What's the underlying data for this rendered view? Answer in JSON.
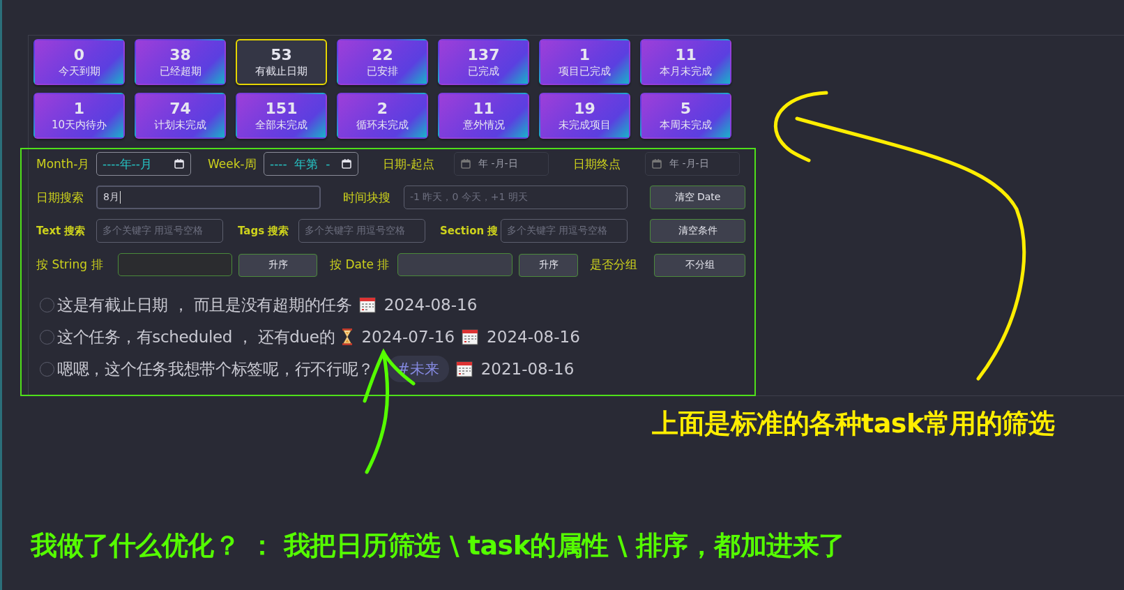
{
  "stat_cards": [
    {
      "count": "0",
      "label": "今天到期",
      "selected": false
    },
    {
      "count": "38",
      "label": "已经超期",
      "selected": false
    },
    {
      "count": "53",
      "label": "有截止日期",
      "selected": true
    },
    {
      "count": "22",
      "label": "已安排",
      "selected": false
    },
    {
      "count": "137",
      "label": "已完成",
      "selected": false
    },
    {
      "count": "1",
      "label": "项目已完成",
      "selected": false
    },
    {
      "count": "11",
      "label": "本月未完成",
      "selected": false
    },
    {
      "count": "1",
      "label": "10天内待办",
      "selected": false
    },
    {
      "count": "74",
      "label": "计划未完成",
      "selected": false
    },
    {
      "count": "151",
      "label": "全部未完成",
      "selected": false
    },
    {
      "count": "2",
      "label": "循环未完成",
      "selected": false
    },
    {
      "count": "11",
      "label": "意外情况",
      "selected": false
    },
    {
      "count": "19",
      "label": "未完成项目",
      "selected": false
    },
    {
      "count": "5",
      "label": "本周未完成",
      "selected": false
    }
  ],
  "filter_rows": [
    [
      {
        "kind": "label",
        "text": "Month-月"
      },
      {
        "kind": "month",
        "value": "----年--月"
      },
      {
        "kind": "label",
        "text": "Week-周"
      },
      {
        "kind": "week",
        "value": "----  年第  -"
      },
      {
        "kind": "label",
        "text": "日期-起点"
      },
      {
        "kind": "date",
        "placeholder": "年 -月-日"
      },
      {
        "kind": "label",
        "text": "日期终点"
      },
      {
        "kind": "date",
        "placeholder": "年 -月-日"
      }
    ],
    [
      {
        "kind": "label",
        "text": "日期搜索"
      },
      {
        "kind": "text",
        "value": "8月",
        "focused": true
      },
      {
        "kind": "label",
        "text": "时间块搜"
      },
      {
        "kind": "text",
        "placeholder": "-1 昨天，0 今天，+1 明天",
        "focused": false
      },
      {
        "kind": "button",
        "text": "清空 Date"
      }
    ],
    [
      {
        "kind": "small-label",
        "text": "Text 搜索"
      },
      {
        "kind": "text",
        "placeholder": "多个关键字 用逗号空格",
        "focused": false
      },
      {
        "kind": "small-label",
        "text": "Tags 搜索"
      },
      {
        "kind": "text",
        "placeholder": "多个关键字 用逗号空格",
        "focused": false
      },
      {
        "kind": "small-label",
        "text": "Section 搜"
      },
      {
        "kind": "text",
        "placeholder": "多个关键字 用逗号空格",
        "focused": false
      },
      {
        "kind": "button",
        "text": "清空条件"
      }
    ],
    [
      {
        "kind": "label",
        "text": "按 String 排"
      },
      {
        "kind": "sort-field"
      },
      {
        "kind": "button",
        "text": "升序"
      },
      {
        "kind": "label",
        "text": "按 Date 排"
      },
      {
        "kind": "select"
      },
      {
        "kind": "button",
        "text": "升序"
      },
      {
        "kind": "label",
        "text": "是否分组"
      },
      {
        "kind": "button",
        "text": "不分组"
      }
    ]
  ],
  "tasks": [
    {
      "checked": false,
      "parts": [
        {
          "kind": "text",
          "text": "这是有截止日期 ， 而且是没有超期的任务"
        },
        {
          "kind": "due",
          "date": "2024-08-16"
        }
      ]
    },
    {
      "checked": false,
      "parts": [
        {
          "kind": "text",
          "text": "这个任务，有scheduled ， 还有due的"
        },
        {
          "kind": "scheduled",
          "date": "2024-07-16"
        },
        {
          "kind": "due",
          "date": "2024-08-16"
        }
      ]
    },
    {
      "checked": false,
      "parts": [
        {
          "kind": "text",
          "text": "嗯嗯，这个任务我想带个标签呢，行不行呢？"
        },
        {
          "kind": "tag",
          "text": "#未来"
        },
        {
          "kind": "due",
          "date": "2021-08-16"
        }
      ]
    }
  ],
  "annotations": {
    "top_note": "上面是标准的各种task常用的筛选",
    "bottom_note": "我做了什么优化？ ： 我把日历筛选 \\ task的属性 \\ 排序，都加进来了"
  }
}
